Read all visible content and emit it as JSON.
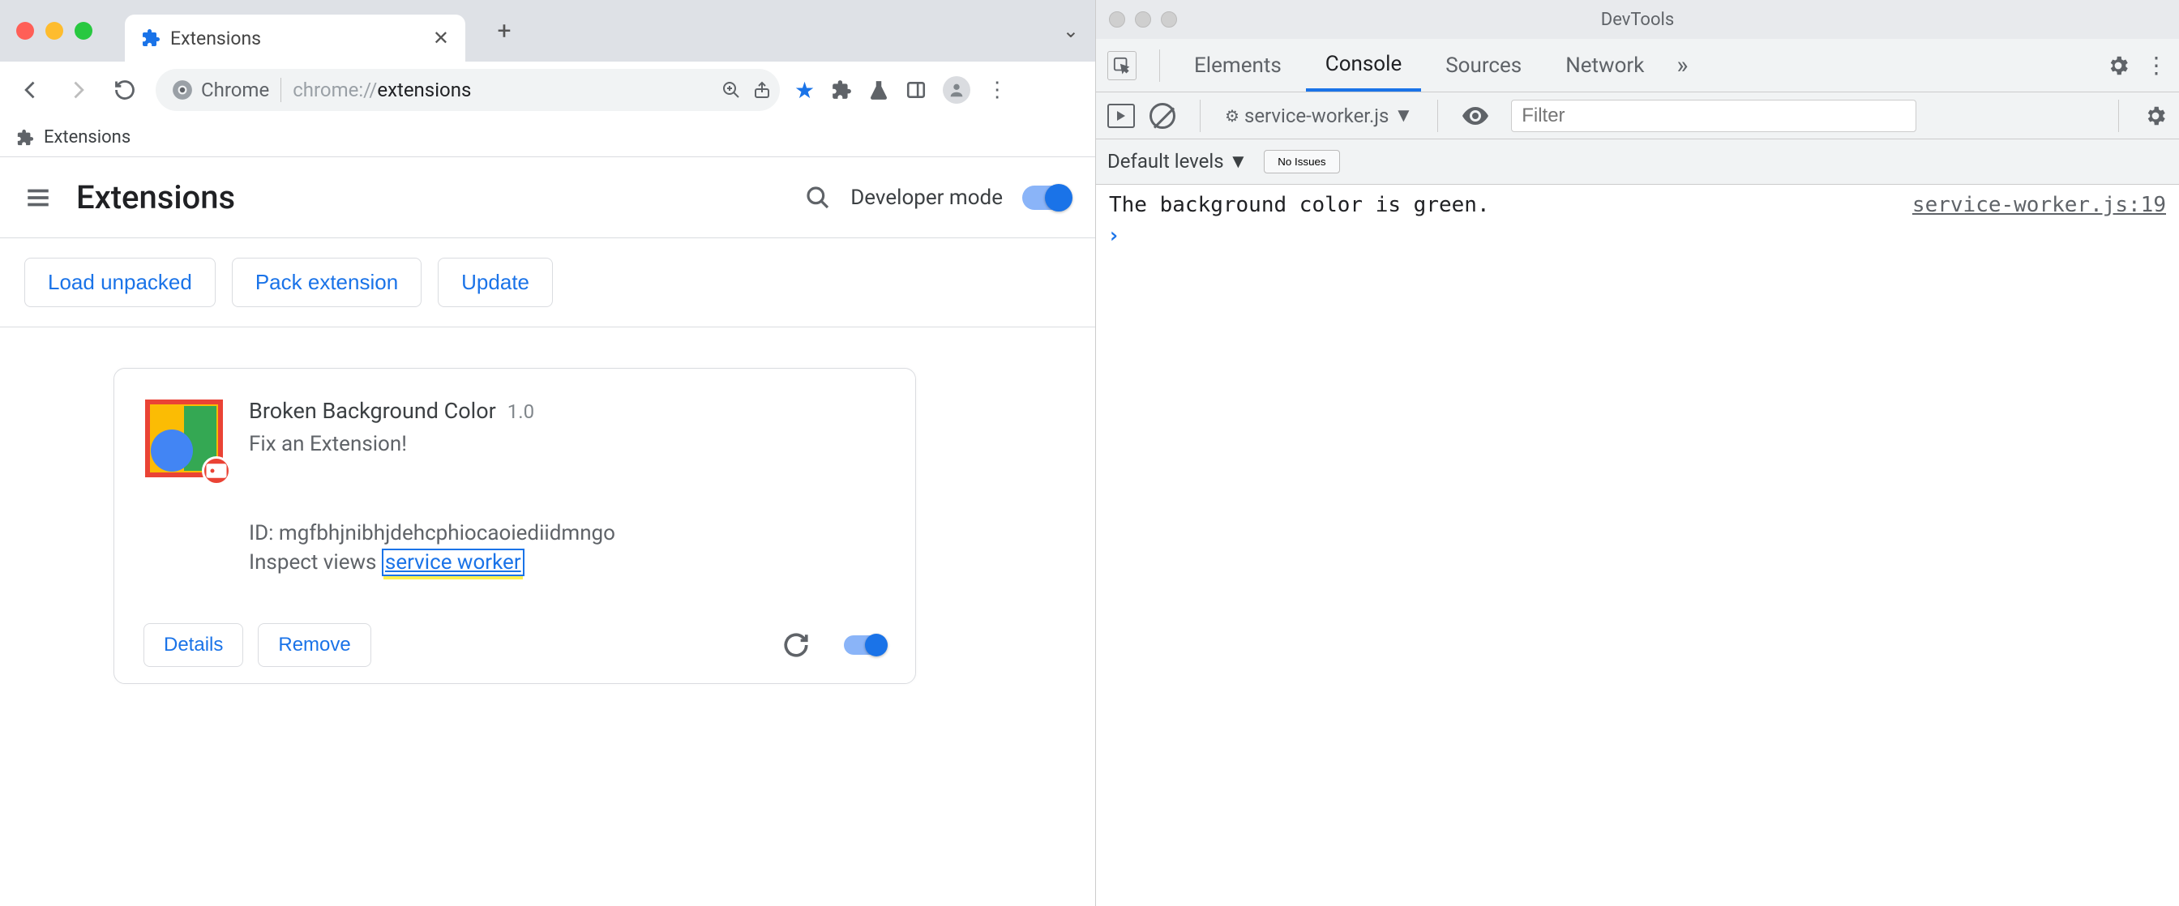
{
  "browser": {
    "tab_title": "Extensions",
    "omnibox_chip": "Chrome",
    "url_prefix": "chrome://",
    "url_path": "extensions",
    "bookmark_label": "Extensions"
  },
  "ext_page": {
    "title": "Extensions",
    "dev_mode_label": "Developer mode",
    "buttons": {
      "load_unpacked": "Load unpacked",
      "pack": "Pack extension",
      "update": "Update"
    },
    "card": {
      "name": "Broken Background Color",
      "version": "1.0",
      "description": "Fix an Extension!",
      "id_label": "ID: ",
      "id": "mgfbhjnibhjdehcphiocaoiediidmngo",
      "inspect_label": "Inspect views ",
      "inspect_link": "service worker",
      "details": "Details",
      "remove": "Remove"
    }
  },
  "devtools": {
    "title": "DevTools",
    "tabs": {
      "elements": "Elements",
      "console": "Console",
      "sources": "Sources",
      "network": "Network"
    },
    "context": "service-worker.js",
    "filter_placeholder": "Filter",
    "levels": "Default levels",
    "issues": "No Issues",
    "log_msg": "The background color is green.",
    "log_src": "service-worker.js:19"
  }
}
